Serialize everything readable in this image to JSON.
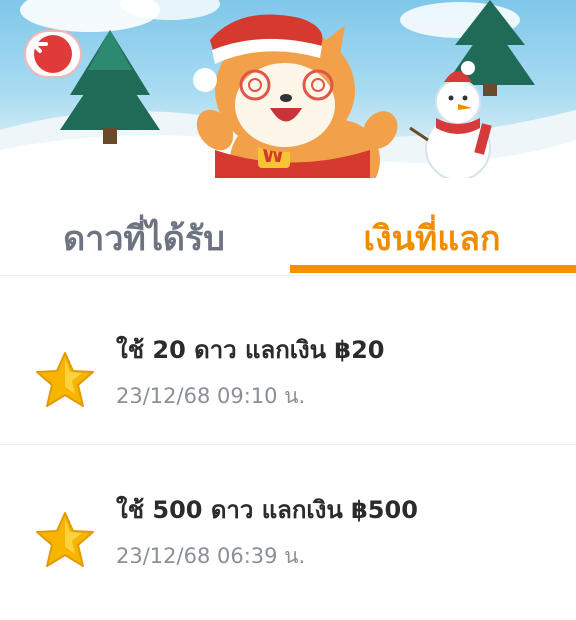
{
  "header": {
    "back_icon": "back-arrow-icon",
    "mascot": "shiba-dog-santa-mascot"
  },
  "tabs": [
    {
      "label": "ดาวที่ได้รับ",
      "active": false
    },
    {
      "label": "เงินที่แลก",
      "active": true
    }
  ],
  "colors": {
    "accent": "#f39200",
    "inactive_tab": "#6d7380",
    "back_button": "#e03a3a"
  },
  "transactions": [
    {
      "title": "ใช้ 20 ดาว แลกเงิน ฿20",
      "time": "23/12/68 09:10 น.",
      "icon": "star-icon"
    },
    {
      "title": "ใช้ 500 ดาว แลกเงิน ฿500",
      "time": "23/12/68 06:39 น.",
      "icon": "star-icon"
    }
  ]
}
